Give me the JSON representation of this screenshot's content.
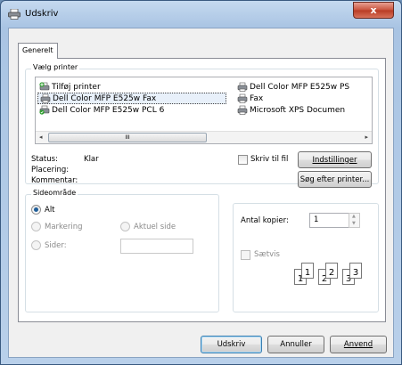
{
  "window": {
    "title": "Udskriv",
    "close_glyph": "x"
  },
  "tabs": [
    {
      "label": "Generelt"
    }
  ],
  "select_printer": {
    "group_title": "Vælg printer",
    "printers": [
      {
        "name": "Tilføj printer",
        "icon": "add-printer-icon"
      },
      {
        "name": "Dell Color MFP E525w Fax",
        "icon": "fax-printer-icon",
        "selected": true
      },
      {
        "name": "Dell Color MFP E525w PCL 6",
        "icon": "default-printer-icon"
      },
      {
        "name": "Dell Color MFP E525w PS",
        "icon": "printer-icon"
      },
      {
        "name": "Fax",
        "icon": "printer-icon"
      },
      {
        "name": "Microsoft XPS Documen",
        "icon": "printer-icon"
      }
    ],
    "scroll_thumb_grip": "III",
    "scroll_left": "◂",
    "scroll_right": "▸"
  },
  "status": {
    "status_label": "Status:",
    "status_value": "Klar",
    "location_label": "Placering:",
    "comment_label": "Kommentar:",
    "print_to_file": "Skriv til fil",
    "preferences_button": "Indstillinger",
    "find_printer_button": "Søg efter printer..."
  },
  "page_range": {
    "group_title": "Sideområde",
    "all": "Alt",
    "selection": "Markering",
    "current_page": "Aktuel side",
    "pages": "Sider:"
  },
  "copies": {
    "label": "Antal kopier:",
    "value": "1",
    "collate": "Sætvis",
    "collate_digits": [
      "1",
      "1",
      "2",
      "2",
      "3",
      "3"
    ]
  },
  "buttons": {
    "print": "Udskriv",
    "cancel": "Annuller",
    "apply": "Anvend"
  }
}
